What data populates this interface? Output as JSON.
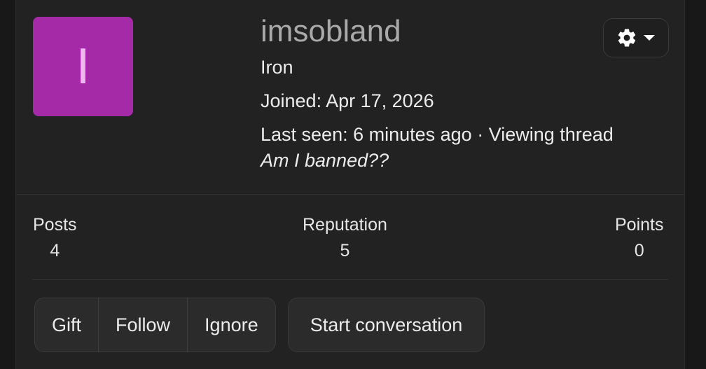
{
  "profile": {
    "avatar_letter": "I",
    "avatar_color": "#a42aa8",
    "username": "imsobland",
    "rank": "Iron",
    "joined": "Joined: Apr 17, 2026",
    "last_seen": "Last seen: 6 minutes ago · Viewing thread",
    "status_text": "Am I banned??"
  },
  "actions_menu": {
    "icon": "gear-icon",
    "caret": "caret-down-icon"
  },
  "stats": [
    {
      "label": "Posts",
      "value": "4"
    },
    {
      "label": "Reputation",
      "value": "5"
    },
    {
      "label": "Points",
      "value": "0"
    }
  ],
  "buttons": {
    "gift": "Gift",
    "follow": "Follow",
    "ignore": "Ignore",
    "start_conversation": "Start conversation"
  }
}
